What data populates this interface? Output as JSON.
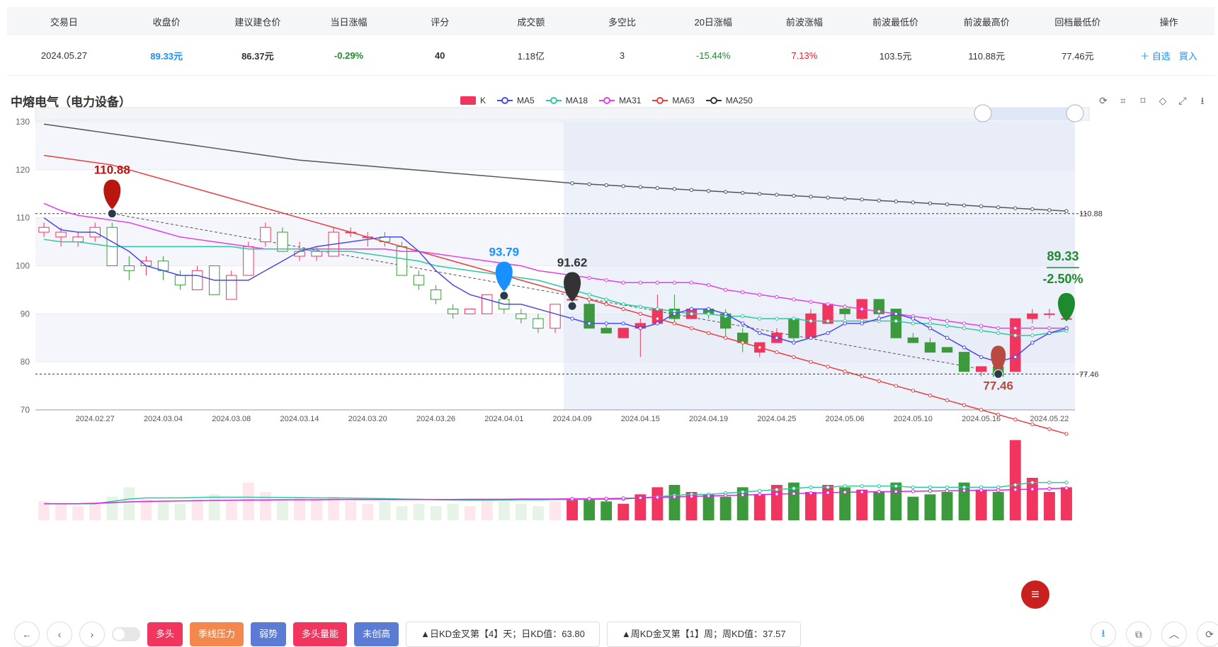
{
  "table": {
    "headers": [
      "交易日",
      "收盘价",
      "建议建仓价",
      "当日涨幅",
      "评分",
      "成交额",
      "多空比",
      "20日涨幅",
      "前波涨幅",
      "前波最低价",
      "前波最高价",
      "回档最低价",
      "操作"
    ],
    "row": {
      "date": "2024.05.27",
      "close": "89.33元",
      "suggest": "86.37元",
      "day_change": "-0.29%",
      "score": "40",
      "turnover": "1.18亿",
      "ratio": "3",
      "chg20": "-15.44%",
      "prev_wave": "7.13%",
      "prev_low": "103.5元",
      "prev_high": "110.88元",
      "pullback_low": "77.46元",
      "action_watch": "＋ 自选",
      "action_buy": "買入"
    }
  },
  "stock_title": "中熔电气（电力设备）",
  "legend": [
    "K",
    "MA5",
    "MA18",
    "MA31",
    "MA63",
    "MA250"
  ],
  "colors": {
    "up": "#f0365f",
    "down": "#3c9a3c",
    "ma5": "#4a4ae8",
    "ma18": "#2ec8a0",
    "ma31": "#e040e8",
    "ma63": "#e84040",
    "ma250": "#555555",
    "accent": "#1890ff"
  },
  "chart_data": {
    "type": "candlestick",
    "ylim": [
      70,
      130
    ],
    "yticks": [
      70,
      80,
      90,
      100,
      110,
      120,
      130
    ],
    "xtick_labels": [
      "2024.02.27",
      "2024.03.04",
      "2024.03.08",
      "2024.03.14",
      "2024.03.20",
      "2024.03.26",
      "2024.04.01",
      "2024.04.09",
      "2024.04.15",
      "2024.04.19",
      "2024.04.25",
      "2024.05.06",
      "2024.05.10",
      "2024.05.16",
      "2024.05.22"
    ],
    "xtick_index": [
      3,
      7,
      11,
      15,
      19,
      23,
      27,
      31,
      35,
      39,
      43,
      47,
      51,
      55,
      59
    ],
    "candles": [
      [
        107,
        109,
        106,
        108
      ],
      [
        106,
        108,
        104,
        107
      ],
      [
        105,
        107,
        104,
        106
      ],
      [
        106,
        109,
        105,
        108
      ],
      [
        108,
        109,
        100,
        100
      ],
      [
        100,
        102,
        97,
        99
      ],
      [
        100,
        102,
        98,
        101
      ],
      [
        101,
        102,
        97,
        99
      ],
      [
        98,
        99,
        95,
        96
      ],
      [
        95,
        100,
        95,
        99
      ],
      [
        100,
        100,
        94,
        94
      ],
      [
        93,
        99,
        93,
        98
      ],
      [
        98,
        105,
        98,
        104
      ],
      [
        105,
        109,
        104,
        108
      ],
      [
        107,
        108,
        103,
        103
      ],
      [
        102,
        105,
        101,
        103
      ],
      [
        102,
        104,
        101,
        103
      ],
      [
        102,
        108,
        102,
        107
      ],
      [
        107,
        108,
        106,
        107
      ],
      [
        106,
        107,
        104,
        106
      ],
      [
        106,
        107,
        104,
        105
      ],
      [
        104,
        105,
        98,
        98
      ],
      [
        98,
        99,
        95,
        96
      ],
      [
        95,
        96,
        92,
        93
      ],
      [
        91,
        92,
        89,
        90
      ],
      [
        90,
        91,
        90,
        91
      ],
      [
        90,
        94,
        90,
        94
      ],
      [
        93,
        94,
        90,
        91
      ],
      [
        90,
        91,
        88,
        89
      ],
      [
        89,
        90,
        86,
        87
      ],
      [
        87,
        92,
        86,
        92
      ],
      [
        93,
        94,
        92,
        93
      ],
      [
        92,
        93,
        87,
        87
      ],
      [
        87,
        88,
        86,
        86
      ],
      [
        85,
        87,
        85,
        87
      ],
      [
        87,
        89,
        81,
        88
      ],
      [
        88,
        94,
        88,
        91
      ],
      [
        91,
        94,
        88,
        89
      ],
      [
        89,
        91,
        89,
        91
      ],
      [
        91,
        91,
        89,
        90
      ],
      [
        90,
        91,
        85,
        87
      ],
      [
        86,
        87,
        82,
        84
      ],
      [
        82,
        84,
        81,
        84
      ],
      [
        84,
        87,
        84,
        86
      ],
      [
        89,
        89,
        84,
        85
      ],
      [
        85,
        91,
        85,
        90
      ],
      [
        88,
        92,
        88,
        92
      ],
      [
        91,
        92,
        89,
        90
      ],
      [
        89,
        93,
        89,
        93
      ],
      [
        93,
        93,
        89,
        90
      ],
      [
        91,
        91,
        85,
        85
      ],
      [
        85,
        86,
        84,
        84
      ],
      [
        84,
        85,
        82,
        82
      ],
      [
        83,
        83,
        82,
        82
      ],
      [
        82,
        82,
        78,
        78
      ],
      [
        78,
        79,
        77,
        79
      ],
      [
        79,
        79,
        77,
        77
      ],
      [
        78,
        89,
        78,
        89
      ],
      [
        89,
        91,
        88,
        90
      ],
      [
        90,
        91,
        89,
        90
      ],
      [
        89,
        90,
        89,
        89
      ]
    ],
    "ma5": [
      110,
      107.5,
      107,
      107,
      105,
      103,
      100,
      99,
      98,
      98,
      97,
      97,
      97,
      99,
      101,
      103,
      104,
      104.5,
      105,
      105.5,
      106,
      106,
      103,
      99,
      96,
      94,
      93,
      92,
      92,
      91,
      90,
      89,
      88,
      88,
      88,
      87,
      88,
      90,
      91,
      91,
      90,
      88,
      86,
      85,
      84,
      85,
      86,
      88,
      88,
      89,
      90,
      89,
      87,
      85,
      83,
      81,
      80,
      81,
      84,
      86,
      87
    ],
    "ma18": [
      105.5,
      105,
      105,
      104.5,
      104,
      104,
      104,
      104,
      104,
      104,
      104,
      104,
      103.5,
      103.5,
      103.5,
      103.5,
      103,
      103,
      103,
      102.5,
      102,
      101.5,
      101,
      100,
      99.5,
      99,
      98.5,
      98,
      97.5,
      97,
      96,
      95,
      94,
      93,
      92,
      91.5,
      91,
      90.5,
      90,
      90,
      89.5,
      89.5,
      89,
      89,
      89,
      88.5,
      88.5,
      88.5,
      88.5,
      88.5,
      88.5,
      88,
      88,
      87.5,
      87,
      86.5,
      86,
      85.5,
      85.5,
      86,
      86.5
    ],
    "ma31": [
      113,
      111.5,
      110.5,
      110,
      109.5,
      109,
      108,
      107,
      106,
      105.5,
      105,
      104.5,
      104,
      103.5,
      103.5,
      103.5,
      103.5,
      103.5,
      103.5,
      103.5,
      103.5,
      103,
      103,
      102.5,
      102,
      101.5,
      101,
      100.5,
      100,
      99,
      98.5,
      98,
      97.5,
      97,
      96.5,
      96.5,
      96.5,
      96.5,
      96.5,
      96,
      95,
      94.5,
      94,
      93.5,
      93,
      92.5,
      92,
      91.5,
      91,
      90.5,
      90,
      89.5,
      89,
      88.5,
      88,
      87.5,
      87,
      87,
      87,
      87,
      87
    ],
    "ma63": [
      123,
      122.5,
      122,
      121.5,
      121,
      120,
      119,
      118,
      117,
      116,
      115,
      114,
      113,
      112,
      111,
      110,
      109,
      108,
      107,
      106,
      105,
      104,
      103,
      102,
      101,
      100,
      99,
      98,
      97,
      96,
      95,
      94,
      93,
      92,
      91,
      90,
      89,
      88,
      87,
      86,
      85,
      84,
      83,
      82,
      81,
      80,
      79,
      78,
      77,
      76,
      75,
      74,
      73,
      72,
      71,
      70,
      69,
      68,
      67,
      66,
      65
    ],
    "ma250": [
      129.5,
      129,
      128.5,
      128,
      127.5,
      127,
      126.5,
      126,
      125.5,
      125,
      124.5,
      124,
      123.5,
      123,
      122.5,
      122,
      121.7,
      121.4,
      121.1,
      120.8,
      120.5,
      120.2,
      119.9,
      119.6,
      119.3,
      119,
      118.7,
      118.4,
      118.1,
      117.8,
      117.5,
      117.2,
      117,
      116.8,
      116.6,
      116.4,
      116.2,
      116,
      115.8,
      115.6,
      115.4,
      115.2,
      115,
      114.8,
      114.6,
      114.4,
      114.2,
      114,
      113.8,
      113.6,
      113.4,
      113.2,
      113,
      112.8,
      112.6,
      112.4,
      112.2,
      112,
      111.8,
      111.6,
      111.4
    ],
    "volume": [
      8,
      7,
      6,
      7,
      10,
      14,
      9,
      8,
      7,
      9,
      11,
      8,
      16,
      12,
      9,
      10,
      9,
      10,
      8,
      7,
      8,
      6,
      7,
      6,
      7,
      6,
      9,
      8,
      7,
      6,
      8,
      9,
      9,
      8,
      7,
      11,
      14,
      15,
      12,
      11,
      10,
      14,
      11,
      15,
      16,
      12,
      15,
      14,
      13,
      12,
      16,
      10,
      11,
      12,
      16,
      13,
      12,
      34,
      18,
      12,
      14
    ],
    "volume_ma": [
      7,
      7,
      7,
      7,
      8,
      9,
      9.5,
      9.5,
      9.5,
      9.7,
      9.8,
      9.8,
      9.8,
      9.7,
      9.7,
      9.6,
      9.5,
      9.5,
      9.4,
      9.3,
      9.2,
      9,
      8.9,
      8.7,
      8.6,
      8.5,
      8.5,
      8.6,
      8.7,
      8.7,
      8.8,
      8.8,
      8.9,
      8.9,
      9,
      9.5,
      10,
      10.5,
      11,
      11,
      11.5,
      12,
      12.5,
      13,
      13.5,
      14,
      14,
      14.5,
      14.5,
      14.5,
      14.5,
      14,
      14,
      14,
      14,
      14,
      14,
      15,
      16,
      16,
      16
    ],
    "volume_ma2": [
      7,
      7,
      7,
      7.2,
      7.5,
      7.8,
      8,
      8.1,
      8.2,
      8.3,
      8.4,
      8.5,
      8.6,
      8.6,
      8.7,
      8.7,
      8.7,
      8.8,
      8.8,
      8.8,
      8.8,
      8.8,
      8.8,
      8.8,
      8.8,
      8.9,
      8.9,
      8.9,
      9,
      9,
      9,
      9.1,
      9.1,
      9.2,
      9.3,
      9.5,
      9.7,
      9.9,
      10.1,
      10.3,
      10.5,
      10.7,
      10.9,
      11.1,
      11.3,
      11.5,
      11.7,
      11.9,
      12,
      12.1,
      12.2,
      12.3,
      12.4,
      12.5,
      12.6,
      12.7,
      12.8,
      13,
      13.2,
      13.4,
      13.6
    ],
    "ref_lines": [
      110.88,
      77.46
    ],
    "markers": [
      {
        "label": "110.88",
        "index": 4,
        "value": 110.88,
        "color": "#b8160f"
      },
      {
        "label": "93.79",
        "index": 27,
        "value": 93.79,
        "color": "#1890ff"
      },
      {
        "label": "91.62",
        "index": 31,
        "value": 91.62,
        "color": "#333333"
      },
      {
        "label": "77.46",
        "index": 56,
        "value": 77.46,
        "color": "#b84a42"
      }
    ],
    "end_label": {
      "price": "89.33",
      "change": "-2.50%",
      "color": "#1e8a2e"
    },
    "ref_labels": [
      "110.88",
      "77.46"
    ]
  },
  "bottom": {
    "tags": [
      {
        "label": "多头",
        "color": "#f0365f"
      },
      {
        "label": "季线压力",
        "color": "#f4874b"
      },
      {
        "label": "弱势",
        "color": "#5b7bd5"
      },
      {
        "label": "多头量能",
        "color": "#f0365f"
      },
      {
        "label": "未创高",
        "color": "#5b7bd5"
      }
    ],
    "info1": "▲日KD金叉第【4】天；日KD值：63.80",
    "info2": "▲周KD金叉第【1】周；周KD值：37.57"
  }
}
